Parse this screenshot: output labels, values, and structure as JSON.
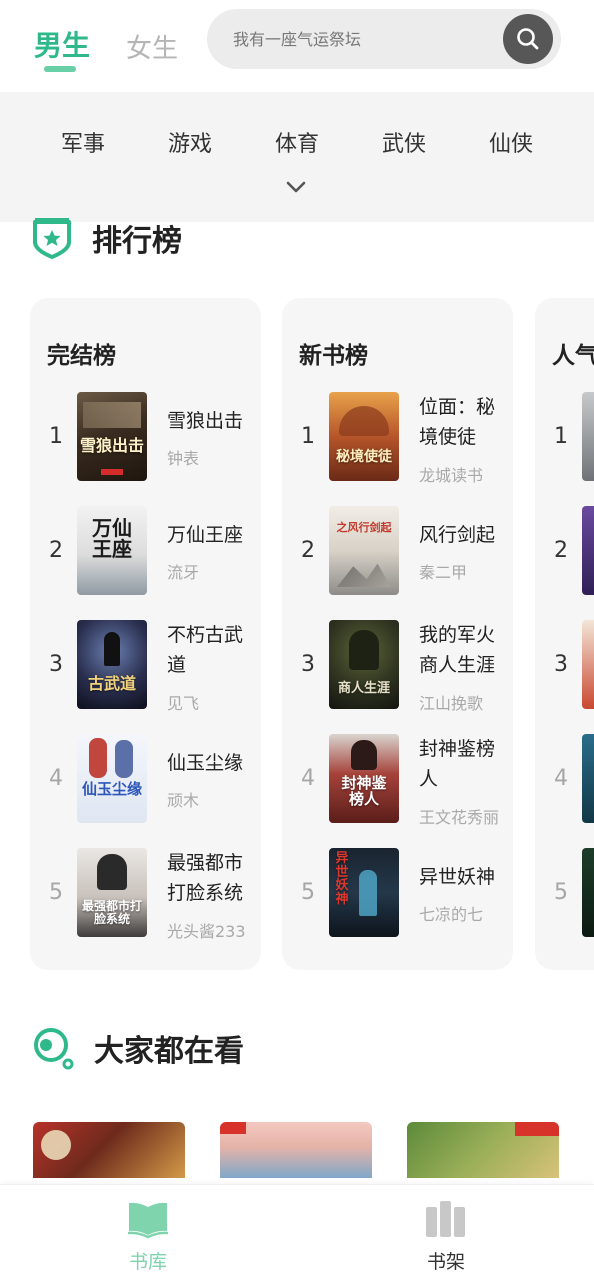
{
  "header": {
    "tabs": [
      {
        "label": "男生",
        "active": true
      },
      {
        "label": "女生",
        "active": false
      }
    ],
    "search": {
      "placeholder": "我有一座气运祭坛",
      "icon": "search-icon"
    }
  },
  "categories": {
    "items": [
      "军事",
      "游戏",
      "体育",
      "武侠",
      "仙侠"
    ],
    "expand_icon": "chevron-down-icon"
  },
  "ranking": {
    "title": "排行榜",
    "icon": "shield-star-icon",
    "accent": "#2fb88a",
    "boards": [
      {
        "title": "完结榜",
        "books": [
          {
            "rank": "1",
            "title": "雪狼出击",
            "author": "钟表",
            "cover_text": "雪狼出击"
          },
          {
            "rank": "2",
            "title": "万仙王座",
            "author": "流牙",
            "cover_text": "万仙王座"
          },
          {
            "rank": "3",
            "title": "不朽古武道",
            "author": "见飞",
            "cover_text": "古武道"
          },
          {
            "rank": "4",
            "title": "仙玉尘缘",
            "author": "顽木",
            "cover_text": "仙玉尘缘"
          },
          {
            "rank": "5",
            "title": "最强都市打脸系统",
            "author": "光头酱233",
            "cover_text": "最强都市打脸系统"
          }
        ]
      },
      {
        "title": "新书榜",
        "books": [
          {
            "rank": "1",
            "title": "位面：秘境使徒",
            "author": "龙城读书",
            "cover_text": "秘境使徒"
          },
          {
            "rank": "2",
            "title": "风行剑起",
            "author": "秦二甲",
            "cover_text": "之风行剑起"
          },
          {
            "rank": "3",
            "title": "我的军火商人生涯",
            "author": "江山挽歌",
            "cover_text": "商人生涯"
          },
          {
            "rank": "4",
            "title": "封神鉴榜人",
            "author": "王文花秀丽",
            "cover_text": "封神鉴榜人"
          },
          {
            "rank": "5",
            "title": "异世妖神",
            "author": "七凉的七",
            "cover_text": "异世妖神"
          }
        ]
      },
      {
        "title": "人气",
        "books": [
          {
            "rank": "1"
          },
          {
            "rank": "2"
          },
          {
            "rank": "3"
          },
          {
            "rank": "4"
          },
          {
            "rank": "5"
          }
        ]
      }
    ]
  },
  "watching": {
    "title": "大家都在看",
    "icon": "search-circle-icon"
  },
  "bottom_nav": {
    "items": [
      {
        "label": "书库",
        "icon": "open-book-icon",
        "active": true,
        "color": "#7fd4ae"
      },
      {
        "label": "书架",
        "icon": "bookshelf-icon",
        "active": false,
        "color": "#333333"
      }
    ]
  }
}
